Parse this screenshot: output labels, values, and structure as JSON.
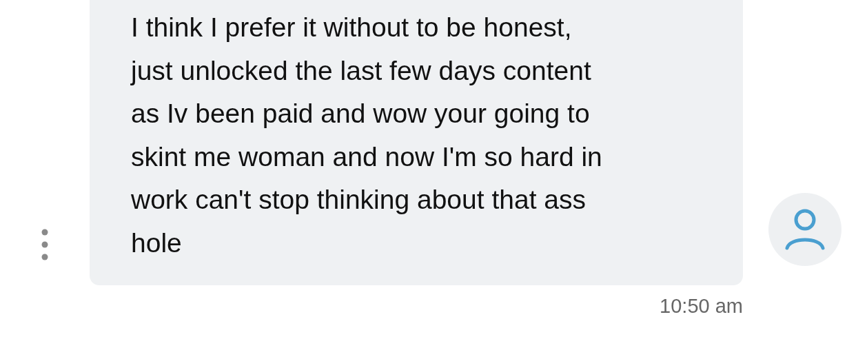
{
  "message": {
    "lines": [
      "I think I prefer it without to be honest,",
      "just unlocked the last few days content",
      "as Iv been paid and wow your going to",
      "skint me woman and now I'm so hard in",
      "work can't stop thinking about that ass",
      "hole"
    ],
    "time": "10:50 am"
  }
}
